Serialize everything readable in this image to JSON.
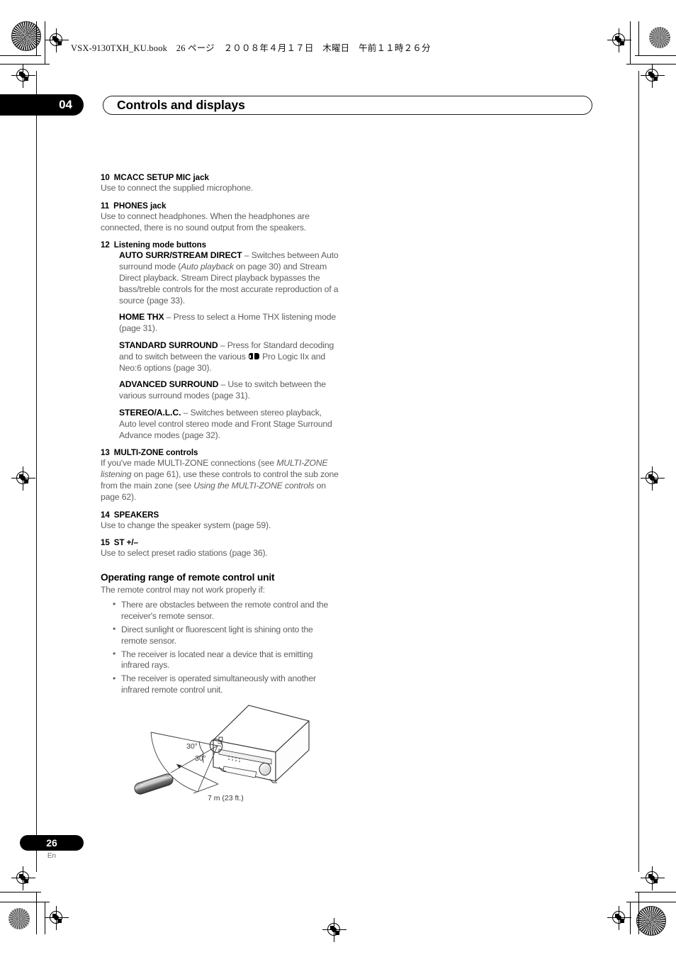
{
  "header": {
    "file_line": "VSX-9130TXH_KU.book　26 ページ　２００８年４月１７日　木曜日　午前１１時２６分"
  },
  "chapter": {
    "number": "04",
    "title": "Controls and displays"
  },
  "entries": [
    {
      "num": "10",
      "title": "MCACC SETUP MIC jack",
      "body": "Use to connect the supplied microphone."
    },
    {
      "num": "11",
      "title": "PHONES jack",
      "body": "Use to connect headphones. When the headphones are connected, there is no sound output from the speakers."
    },
    {
      "num": "12",
      "title": "Listening mode buttons"
    },
    {
      "num": "13",
      "title": "MULTI-ZONE controls"
    },
    {
      "num": "14",
      "title": "SPEAKERS",
      "body": "Use to change the speaker system (page 59)."
    },
    {
      "num": "15",
      "title": "ST +/–",
      "body": "Use to select preset radio stations (page 36)."
    }
  ],
  "listening_modes": {
    "auto_surr": {
      "label": "AUTO SURR/STREAM DIRECT",
      "text_1": " – Switches between Auto surround mode (",
      "italic_1": "Auto playback",
      "text_2": " on page 30) and Stream Direct playback. Stream Direct playback bypasses the bass/treble controls for the most accurate reproduction of a source (page 33)."
    },
    "home_thx": {
      "label": "HOME THX",
      "text": " – Press to select a Home THX listening mode (page 31)."
    },
    "standard_surround": {
      "label": "STANDARD SURROUND",
      "text_1": " – Press for Standard decoding and to switch between the various ",
      "dolby_icon": "dolby-double-d-icon",
      "text_2": " Pro Logic IIx and Neo:6 options (page 30)."
    },
    "advanced_surround": {
      "label": "ADVANCED SURROUND",
      "text": " – Use to switch between the various surround modes (page 31)."
    },
    "stereo_alc": {
      "label": "STEREO/A.L.C.",
      "text": " – Switches between stereo playback, Auto level control stereo mode and Front Stage Surround Advance modes (page 32)."
    }
  },
  "multizone": {
    "text_1": "If you've made MULTI-ZONE connections (see ",
    "italic_1": "MULTI-ZONE listening",
    "text_2": " on page 61), use these controls to control the sub zone from the main zone (see ",
    "italic_2": "Using the MULTI-ZONE controls",
    "text_3": " on page 62)."
  },
  "operating_range": {
    "title": "Operating range of remote control unit",
    "intro": "The remote control may not work properly if:",
    "bullets": [
      "There are obstacles between the remote control and the receiver's remote sensor.",
      "Direct sunlight or fluorescent light is shining onto the remote sensor.",
      "The receiver is located near a device that is emitting infrared rays.",
      "The receiver is operated simultaneously with another infrared remote control unit."
    ]
  },
  "figure": {
    "angle_upper": "30°",
    "angle_lower": "30°",
    "distance": "7 m (23 ft.)"
  },
  "footer": {
    "page_number": "26",
    "language": "En"
  },
  "colors": {
    "body_text": "#5e5e5e",
    "heading_text": "#000000",
    "badge_bg": "#000000"
  }
}
